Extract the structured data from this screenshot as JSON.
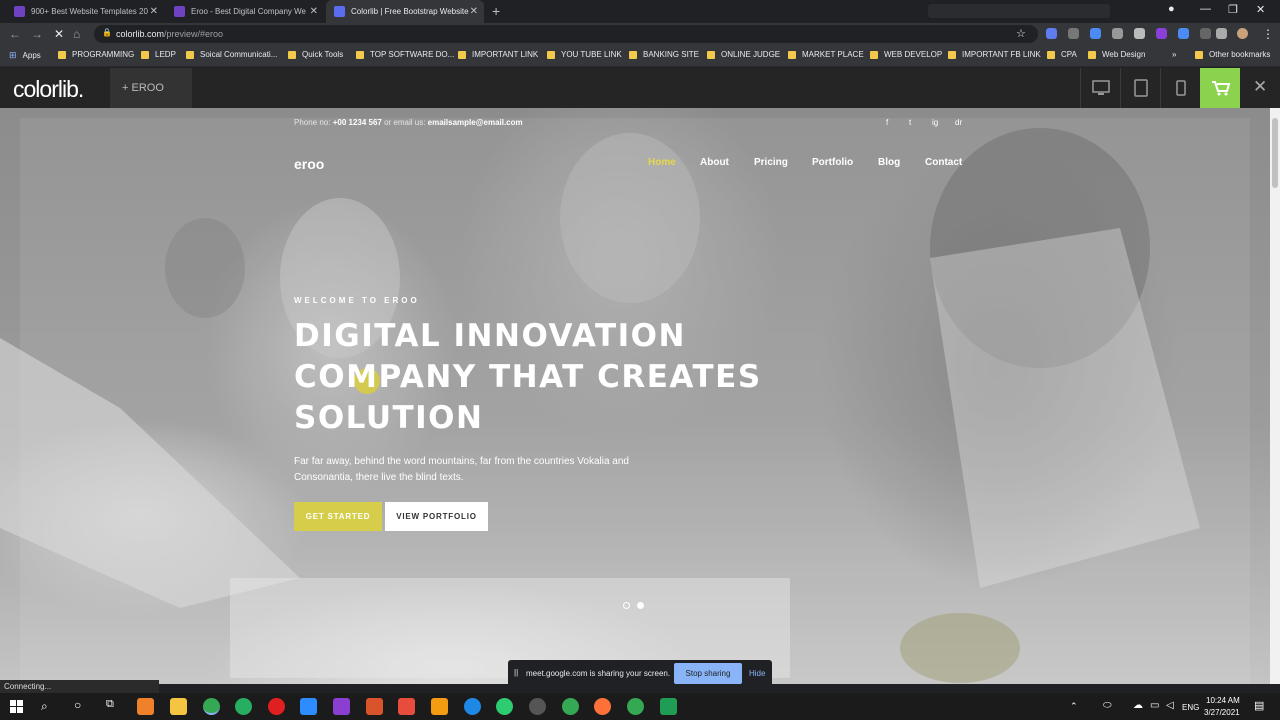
{
  "browser": {
    "tabs": [
      {
        "title": "900+ Best Website Templates 20"
      },
      {
        "title": "Eroo - Best Digital Company We"
      },
      {
        "title": "Colorlib | Free Bootstrap Website"
      }
    ],
    "new_tab": "+",
    "url_host": "colorlib.com",
    "url_path": "/preview/#eroo",
    "bookmarks": [
      "Apps",
      "PROGRAMMING",
      "LEDP",
      "Soical Communicati...",
      "Quick Tools",
      "TOP SOFTWARE DO...",
      "IMPORTANT LINK",
      "YOU TUBE LINK",
      "BANKING SITE",
      "ONLINE JUDGE",
      "MARKET PLACE",
      "WEB DEVELOP",
      "IMPORTANT FB LINK",
      "CPA",
      "Web Design",
      "Other bookmarks"
    ],
    "status_text": "Connecting..."
  },
  "colorlib_bar": {
    "logo": "colorlib.",
    "theme_label": "+   EROO",
    "accent": "#8bd34f"
  },
  "site": {
    "topline_prefix": "Phone no: ",
    "phone": "+00 1234 567",
    "topline_mid": " or email us: ",
    "email": "emailsample@email.com",
    "logo": "eroo",
    "menu": [
      "Home",
      "About",
      "Pricing",
      "Portfolio",
      "Blog",
      "Contact"
    ],
    "social": [
      "f",
      "t",
      "ig",
      "dr"
    ],
    "kicker": "WELCOME TO EROO",
    "headline": [
      "DIGITAL INNOVATION",
      "COMPANY THAT CREATES",
      "SOLUTION"
    ],
    "description": "Far far away, behind the word mountains, far from the countries Vokalia and Consonantia, there live the blind texts.",
    "btn_primary": "GET STARTED",
    "btn_secondary": "VIEW PORTFOLIO",
    "accent": "#d6cd4b"
  },
  "share_banner": {
    "pause": "||",
    "text": "meet.google.com is sharing your screen.",
    "stop": "Stop sharing",
    "hide": "Hide"
  },
  "taskbar": {
    "lang": "ENG",
    "time": "10:24 AM",
    "date": "3/27/2021"
  }
}
